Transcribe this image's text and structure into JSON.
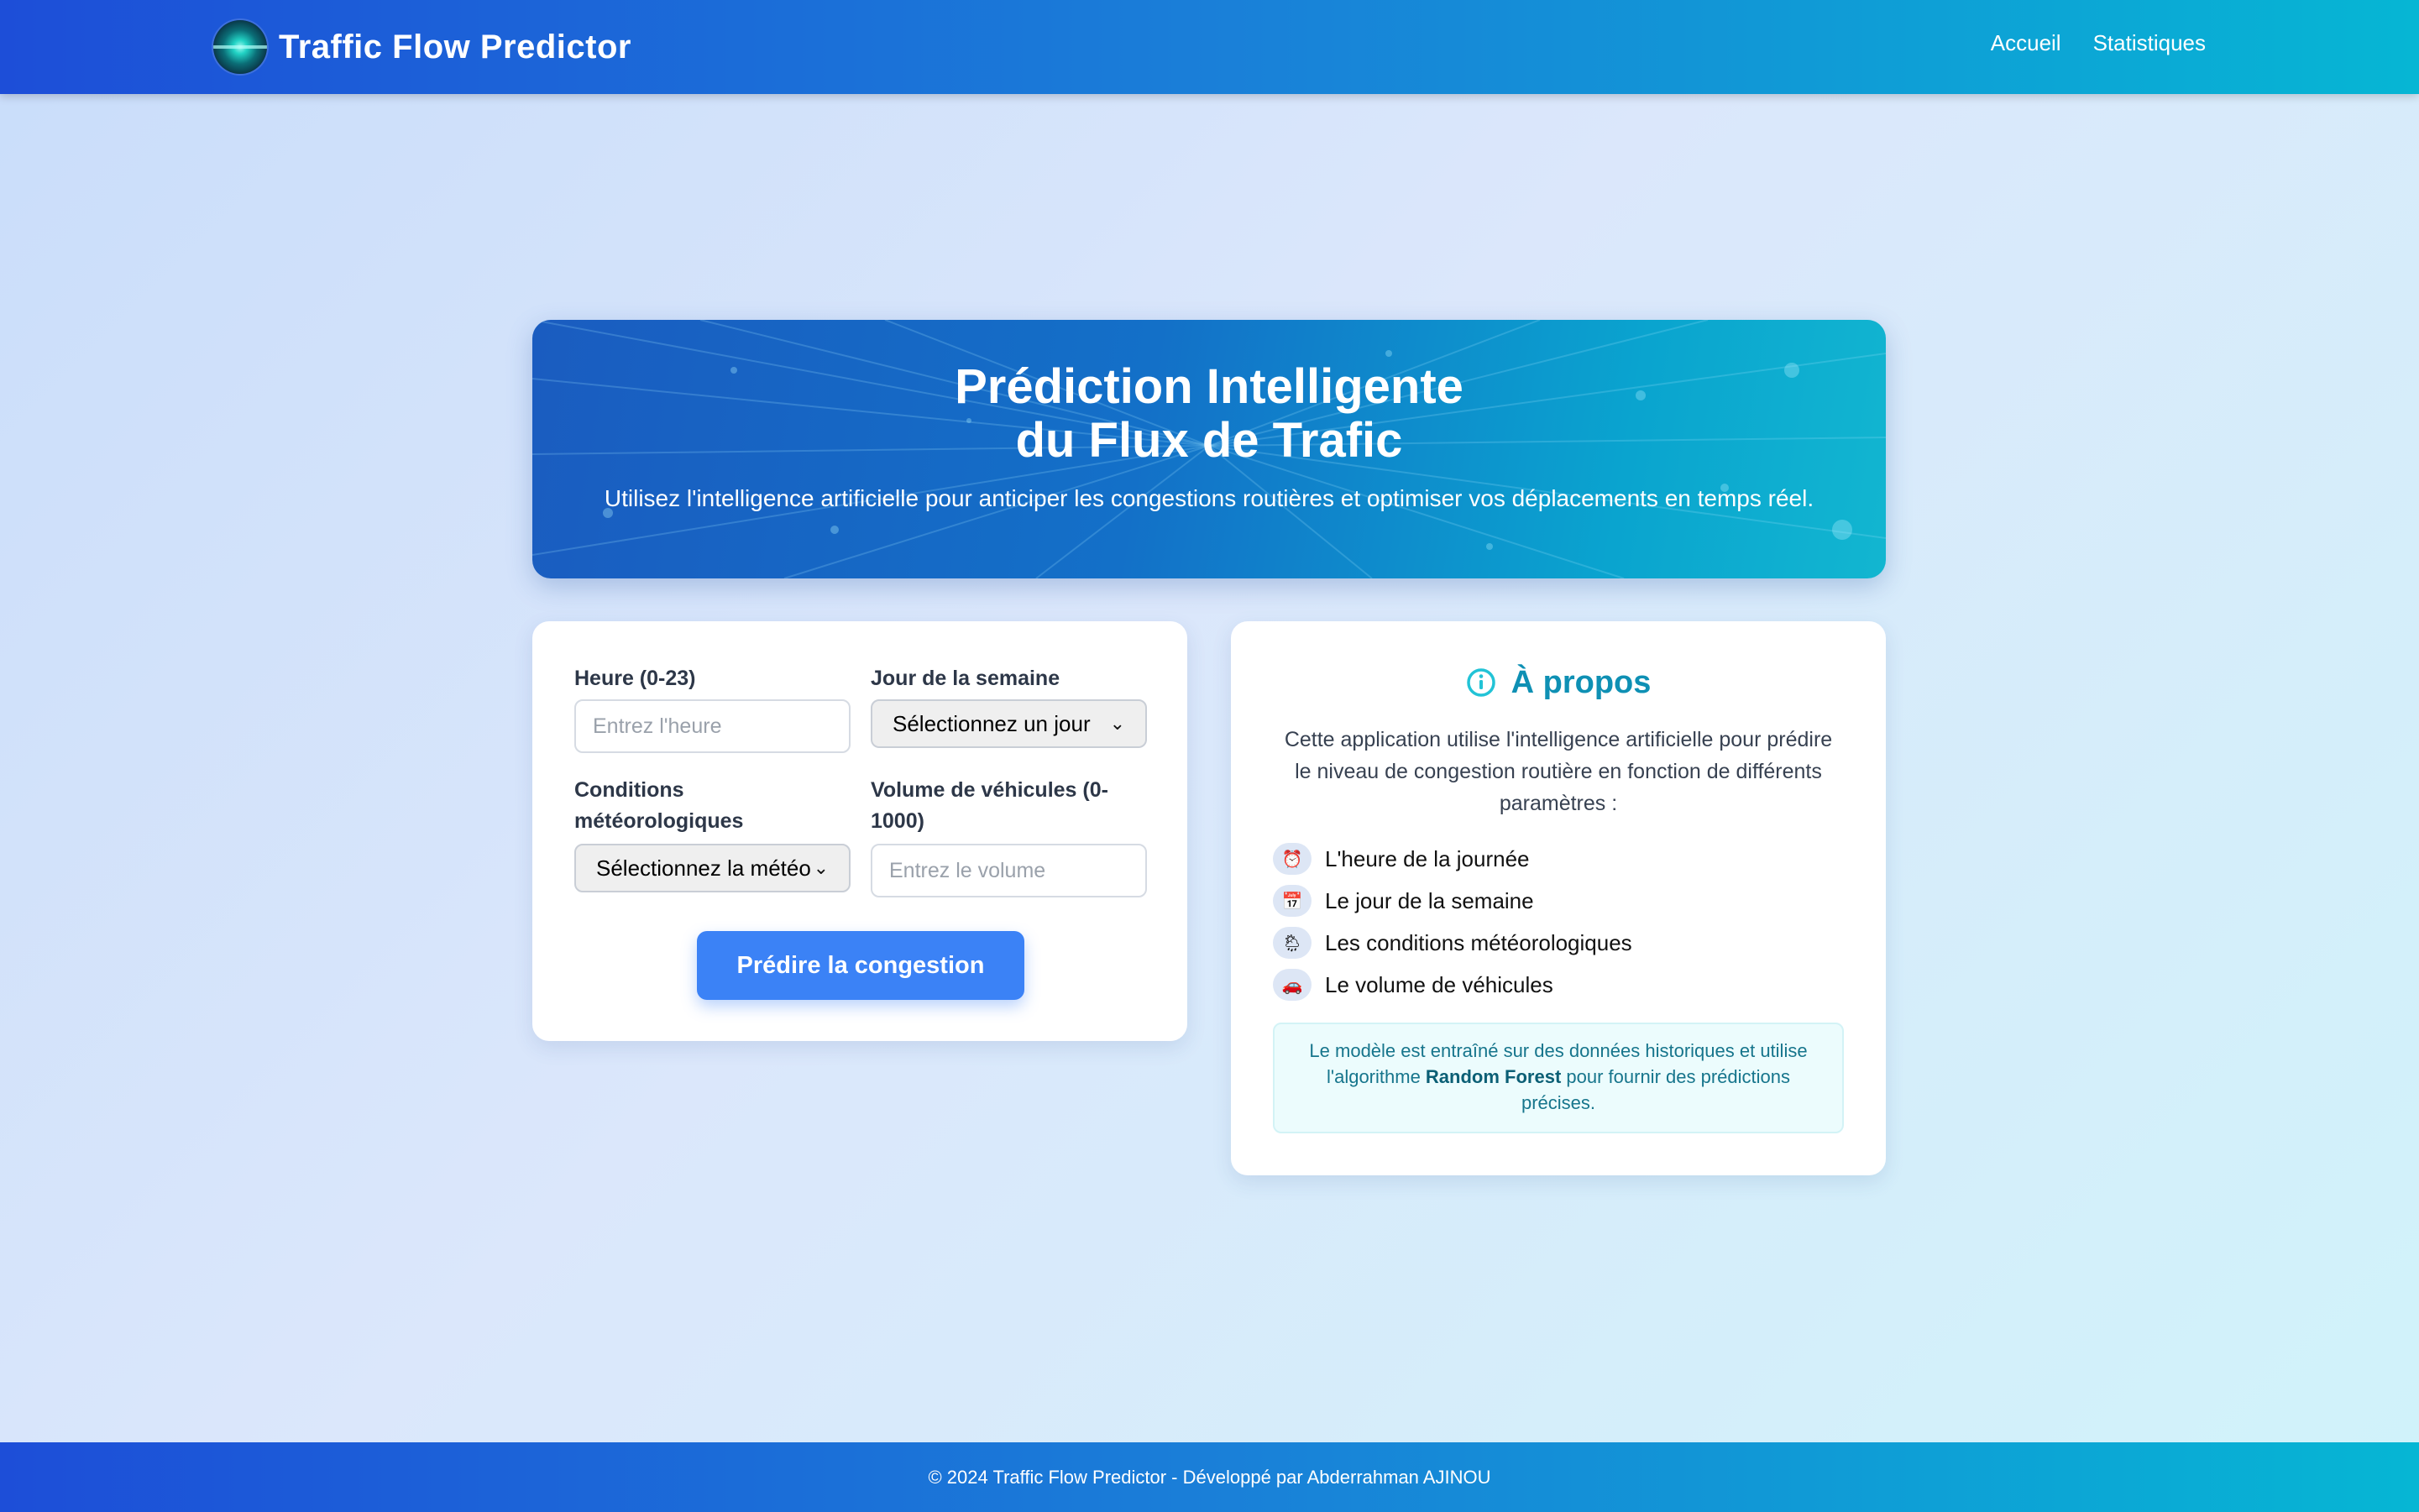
{
  "navbar": {
    "brand": "Traffic Flow Predictor",
    "links": [
      "Accueil",
      "Statistiques"
    ]
  },
  "hero": {
    "title_line1": "Prédiction Intelligente",
    "title_line2": "du Flux de Trafic",
    "description": "Utilisez l'intelligence artificielle pour anticiper les congestions routières et optimiser vos déplacements en temps réel."
  },
  "form": {
    "hour_label": "Heure (0-23)",
    "hour_placeholder": "Entrez l'heure",
    "day_label": "Jour de la semaine",
    "day_selected": "Sélectionnez un jour",
    "weather_label_line1": "Conditions",
    "weather_label_line2": "météorologiques",
    "weather_selected": "Sélectionnez la météo",
    "volume_label_line1": "Volume de véhicules (0-",
    "volume_label_line2": "1000)",
    "volume_placeholder": "Entrez le volume",
    "submit_label": "Prédire la congestion"
  },
  "about": {
    "title": "À propos",
    "description": "Cette application utilise l'intelligence artificielle pour prédire le niveau de congestion routière en fonction de différents paramètres :",
    "features": [
      {
        "icon": "alarm-clock-icon",
        "glyph": "⏰",
        "label": "L'heure de la journée"
      },
      {
        "icon": "calendar-icon",
        "glyph": "📅",
        "label": "Le jour de la semaine"
      },
      {
        "icon": "weather-icon",
        "glyph": "🌦",
        "label": "Les conditions météorologiques"
      },
      {
        "icon": "car-icon",
        "glyph": "🚗",
        "label": "Le volume de véhicules"
      }
    ],
    "note_before": "Le modèle est entraîné sur des données historiques et utilise l'algorithme ",
    "note_bold": "Random Forest",
    "note_after": " pour fournir des prédictions précises."
  },
  "footer": {
    "text": "© 2024 Traffic Flow Predictor - Développé par Abderrahman AJINOU"
  },
  "colors": {
    "primary": "#3b82f6",
    "nav_start": "#1d4ed8",
    "nav_end": "#06b6d4",
    "about_title": "#0e90b4"
  }
}
